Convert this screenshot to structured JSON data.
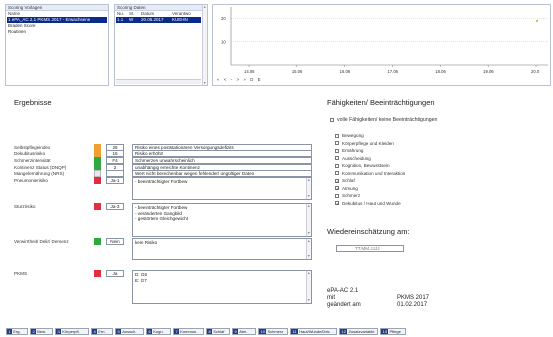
{
  "scoring_vorlagen": {
    "title": "Scoring Vorlagen",
    "column": "Name",
    "items": [
      "1 ePA_AC 2.1 PKMS 2017 - Erwachsene",
      "Braden Score",
      "Routinen"
    ],
    "selected_index": 0
  },
  "scoring_daten": {
    "title": "Scoring Daten",
    "columns": [
      "Nu.",
      "St.",
      "Datum",
      "Verantwo"
    ],
    "rows": [
      {
        "nu": "1.1",
        "st": "W",
        "datum": "20.06.2017",
        "verantwortlich": "KUEHN"
      }
    ]
  },
  "chart": {
    "y_ticks": [
      "20",
      "10"
    ],
    "x_ticks": [
      "14.06",
      "15.06",
      "16.06",
      "17.06",
      "18.06",
      "19.06",
      "20.0"
    ],
    "nav": [
      "«",
      "<",
      "-",
      ">",
      "»",
      "D",
      "E"
    ]
  },
  "chart_data": {
    "type": "scatter",
    "x": [
      "20.06"
    ],
    "y": [
      19
    ],
    "ylim": [
      0,
      25
    ]
  },
  "ergebnisse": {
    "title": "Ergebnisse",
    "rows": [
      {
        "label": "Selbstpflegeindex",
        "color": "#f0a030",
        "value": "25",
        "text": "Risiko eines poststationären Versorgungsdefizits"
      },
      {
        "label": "Dekubitusrisiko",
        "color": "#f0a030",
        "value": "15",
        "text": "Risiko erhöht!"
      },
      {
        "label": "Schmerzintensität",
        "color": "#2fa840",
        "value": "F4",
        "text": "Schmerzen unwahrscheinlich"
      },
      {
        "label": "Kontinenz Status (DNQP)",
        "color": "#2fa840",
        "value": "2",
        "text": "unabhängig erreichte Kontinenz"
      },
      {
        "label": "Mangelernährung (NRS)",
        "color": "#e8e8e8",
        "value": "",
        "text": "Wert nicht berechenbar wegen fehlender/ ungültiger Daten"
      },
      {
        "label": "Pneumonierisiko",
        "color": "#e03040",
        "value": "Ja-1",
        "text": "- beeinträchtigter Fortbew"
      },
      {
        "label": "Sturzrisiko",
        "color": "#e03040",
        "value": "Ja-3",
        "text": "- beeinträchtigter Fortbew\n- veränderten Gangbild\n- gestörtem Gleichgewicht"
      },
      {
        "label": "Verwirrtheit/ Delir/ Demenz",
        "color": "#2fa840",
        "value": "Nein",
        "text": "kein Risiko"
      },
      {
        "label": "PKMS",
        "color": "#e03040",
        "value": "Ja",
        "text": "D: G6\nE: G7"
      }
    ]
  },
  "faehigkeiten": {
    "title": "Fähigkeiten/ Beeinträchtigungen",
    "volle_label": "volle Fähigkeiten/ keine Beeinträchtigungen",
    "volle_checked": false,
    "items": [
      {
        "label": "Bewegung",
        "checked": false
      },
      {
        "label": "Körperpflege und Kleiden",
        "checked": false
      },
      {
        "label": "Ernährung",
        "checked": false
      },
      {
        "label": "Ausscheidung",
        "checked": false
      },
      {
        "label": "Kognition, Bewusstsein",
        "checked": false
      },
      {
        "label": "Kommunikation und Interaktion",
        "checked": false
      },
      {
        "label": "Schlaf",
        "checked": true
      },
      {
        "label": "Atmung",
        "checked": true
      },
      {
        "label": "Schmerz",
        "checked": false
      },
      {
        "label": "Dekubitus / Haut und Wunde",
        "checked": true
      }
    ]
  },
  "wiedereinschaetzung": {
    "title": "Wiedereinschätzung am:",
    "placeholder": "TT.MM.JJJJ"
  },
  "footer_info": {
    "name": "ePA-AC 2.1",
    "mit_label": "mit",
    "mit_value": "PKMS 2017",
    "geaendert_label": "geändert am",
    "geaendert_value": "01.02.2017"
  },
  "tabs": [
    {
      "num": "1",
      "label": "Erg."
    },
    {
      "num": "2",
      "label": "Bew."
    },
    {
      "num": "3",
      "label": "Körperpfl."
    },
    {
      "num": "4",
      "label": "Ern."
    },
    {
      "num": "5",
      "label": "Aussch."
    },
    {
      "num": "6",
      "label": "Kogn."
    },
    {
      "num": "7",
      "label": "Kommun."
    },
    {
      "num": "8",
      "label": "Schlaf"
    },
    {
      "num": "9",
      "label": "Atm."
    },
    {
      "num": "10",
      "label": "Schmerz"
    },
    {
      "num": "11",
      "label": "Haut/Wunde/Dek."
    },
    {
      "num": "12",
      "label": "Zusatzvariable"
    },
    {
      "num": "13",
      "label": "Pflege"
    }
  ]
}
